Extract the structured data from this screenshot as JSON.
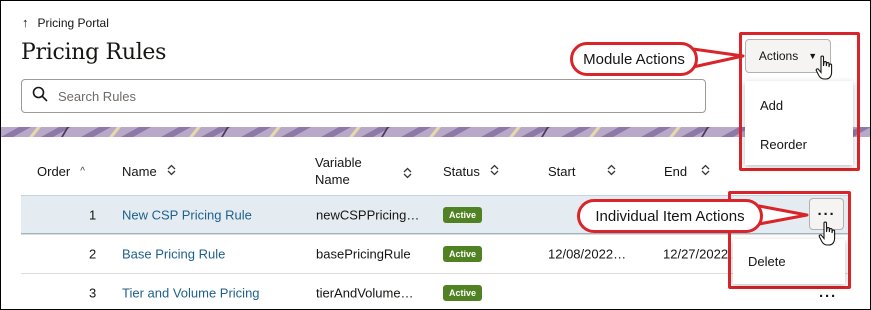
{
  "nav": {
    "back_label": "Pricing Portal"
  },
  "page": {
    "title": "Pricing Rules"
  },
  "search": {
    "placeholder": "Search Rules"
  },
  "columns": {
    "order": "Order",
    "name": "Name",
    "variable_name_line1": "Variable",
    "variable_name_line2": "Name",
    "status": "Status",
    "start": "Start",
    "end": "End"
  },
  "rows": [
    {
      "order": "1",
      "name": "New CSP Pricing Rule",
      "variable_name": "newCSPPricing…",
      "status": "Active",
      "start": "",
      "end": ""
    },
    {
      "order": "2",
      "name": "Base Pricing Rule",
      "variable_name": "basePricingRule",
      "status": "Active",
      "start": "12/08/2022…",
      "end": "12/27/2022…"
    },
    {
      "order": "3",
      "name": "Tier and Volume Pricing",
      "variable_name": "tierAndVolume…",
      "status": "Active",
      "start": "",
      "end": ""
    }
  ],
  "actions_button": {
    "label": "Actions"
  },
  "actions_menu": {
    "items": [
      "Add",
      "Reorder"
    ]
  },
  "item_menu": {
    "items": [
      "Delete"
    ]
  },
  "kebab_label": "···",
  "callouts": {
    "module_actions": "Module Actions",
    "item_actions": "Individual Item Actions"
  },
  "colors": {
    "accent_red": "#d9252a",
    "link_blue": "#1e5f8c",
    "status_green": "#508223",
    "selected_row": "#e4ecf1"
  },
  "icons": {
    "back": "arrow-up-icon",
    "search": "search-icon",
    "sort": "sort-updown-icon",
    "sort_asc": "sort-ascending-icon",
    "caret": "caret-down-icon",
    "pointer": "hand-pointer-icon"
  }
}
